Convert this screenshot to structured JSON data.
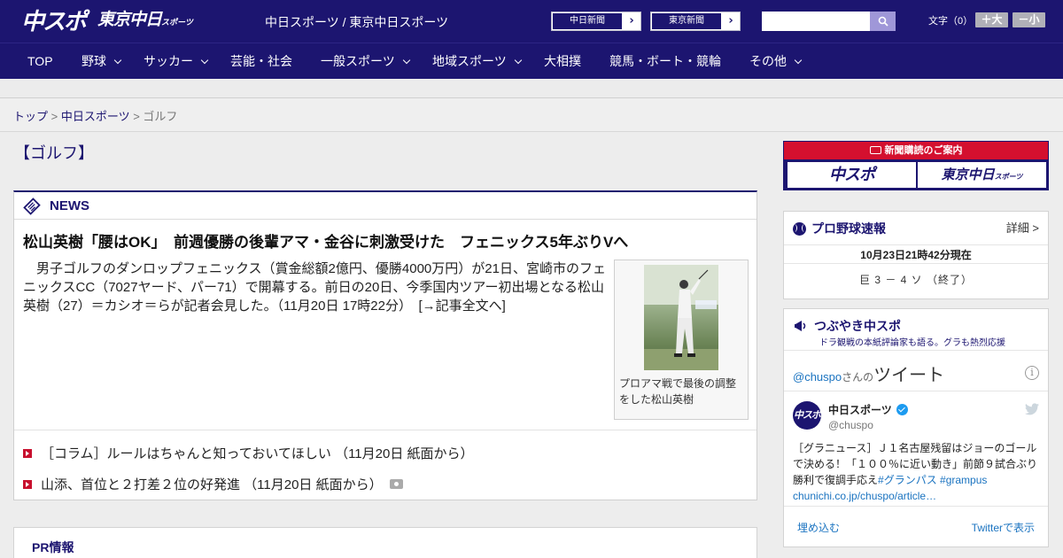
{
  "header": {
    "logo_main": "中スポ",
    "logo_tokyo": "東京中日",
    "logo_tokyo_small": "スポーツ",
    "site_name": "中日スポーツ / 東京中日スポーツ",
    "paper_buttons": [
      {
        "label": "中日新聞"
      },
      {
        "label": "東京新聞"
      }
    ],
    "search_placeholder": "",
    "font_size_label": "文字（0）",
    "font_bigger": "＋大",
    "font_smaller": "－小"
  },
  "nav": {
    "items": [
      {
        "label": "TOP",
        "has_dropdown": false
      },
      {
        "label": "野球",
        "has_dropdown": true
      },
      {
        "label": "サッカー",
        "has_dropdown": true
      },
      {
        "label": "芸能・社会",
        "has_dropdown": false
      },
      {
        "label": "一般スポーツ",
        "has_dropdown": true
      },
      {
        "label": "地域スポーツ",
        "has_dropdown": true
      },
      {
        "label": "大相撲",
        "has_dropdown": false
      },
      {
        "label": "競馬・ボート・競輪",
        "has_dropdown": false
      },
      {
        "label": "その他",
        "has_dropdown": true
      }
    ]
  },
  "breadcrumb": {
    "home": "トップ",
    "sep": " > ",
    "section": "中日スポーツ",
    "current": "ゴルフ"
  },
  "page_title": "【ゴルフ】",
  "news": {
    "section_label": "NEWS",
    "headline": "松山英樹「腰はOK」　前週優勝の後輩アマ・金谷に刺激受けた　フェニックス5年ぶりVへ",
    "lead": "男子ゴルフのダンロップフェニックス（賞金総額2億円、優勝4000万円）が21日、宮崎市のフェニックスCC（7027ヤード、パー71）で開幕する。前日の20日、今季国内ツアー初出場となる松山英樹（27）＝カシオ＝らが記者会見した。（11月20日 17時22分）　[→記事全文へ]",
    "photo_caption": "プロアマ戦で最後の調整をした松山英樹",
    "links": [
      {
        "text": "［コラム］ルールはちゃんと知っておいてほしい （11月20日 紙面から）",
        "has_photo": false
      },
      {
        "text": "山添、首位と２打差２位の好発進 （11月20日 紙面から）",
        "has_photo": true
      }
    ]
  },
  "pr": {
    "title": "PR情報"
  },
  "subscribe": {
    "title": "新聞購読のご案内",
    "btn_a": "中スポ",
    "btn_b": "東京中日",
    "btn_b_small": "スポーツ"
  },
  "baseball": {
    "title": "プロ野球速報",
    "detail": "詳細 >",
    "as_of": "10月23日21時42分現在",
    "score": "巨 3 － 4 ソ （終了）"
  },
  "twitter": {
    "title": "つぶやき中スポ",
    "subtitle": "ドラ観戦の本紙評論家も語る。グラも熱烈応援",
    "handle": "@chuspo",
    "handle_suffix": "さんの",
    "tweets_label": "ツイート",
    "info": "i",
    "account_name": "中日スポーツ",
    "account_handle": "@chuspo",
    "avatar_text": "中スポ",
    "body_plain": "［グラニュース］Ｊ１名古屋残留はジョーのゴールで決める！「１００％に近い動き」前節９試合ぶり勝利で復調手応え",
    "body_tags": "#グランパス #grampus",
    "body_link": "chunichi.co.jp/chuspo/article…",
    "embed": "埋め込む",
    "view": "Twitterで表示"
  },
  "colors": {
    "brand_navy": "#1c1570",
    "accent_red": "#d4102f",
    "link_blue": "#1a73c0"
  }
}
